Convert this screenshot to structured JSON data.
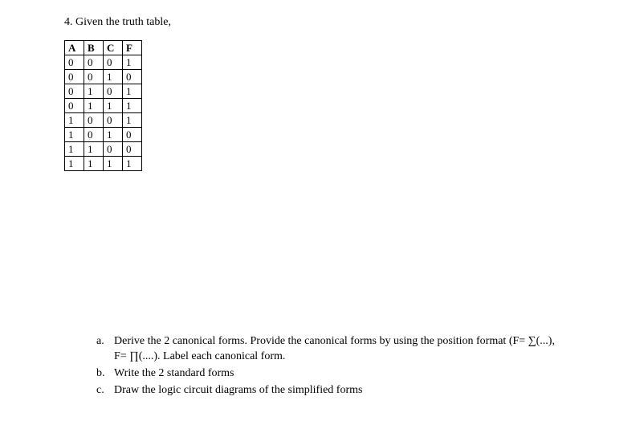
{
  "question": {
    "number_text": "4. Given the truth table,",
    "table": {
      "headers": [
        "A",
        "B",
        "C",
        "F"
      ],
      "rows": [
        [
          "0",
          "0",
          "0",
          "1"
        ],
        [
          "0",
          "0",
          "1",
          "0"
        ],
        [
          "0",
          "1",
          "0",
          "1"
        ],
        [
          "0",
          "1",
          "1",
          "1"
        ],
        [
          "1",
          "0",
          "0",
          "1"
        ],
        [
          "1",
          "0",
          "1",
          "0"
        ],
        [
          "1",
          "1",
          "0",
          "0"
        ],
        [
          "1",
          "1",
          "1",
          "1"
        ]
      ]
    },
    "subs": {
      "a": {
        "letter": "a.",
        "line1": "Derive the 2 canonical forms. Provide the canonical forms by using the position format (F= ∑(...),",
        "line2": "F= ∏(....). Label each canonical form."
      },
      "b": {
        "letter": "b.",
        "text": "Write the 2 standard forms"
      },
      "c": {
        "letter": "c.",
        "text": "Draw the logic circuit diagrams of the simplified forms"
      }
    }
  }
}
